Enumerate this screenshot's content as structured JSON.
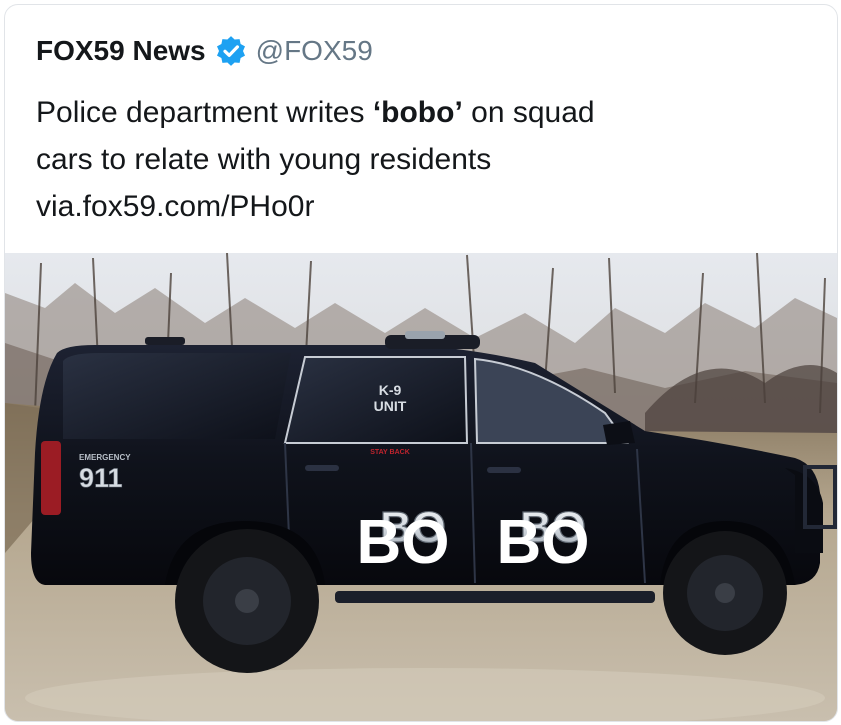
{
  "tweet": {
    "display_name": "FOX59 News",
    "handle": "@FOX59",
    "text_part1": "Police department writes ",
    "text_bold": "‘bobo’",
    "text_part2": " on squad",
    "text_line2": "cars to relate with young residents",
    "link": "via.fox59.com/PHo0r",
    "verified_icon": "verified-badge-icon",
    "accent_color": "#1da1f2"
  },
  "photo": {
    "subject": "police-suv",
    "decals": {
      "window_line1": "K-9",
      "window_line2": "UNIT",
      "window_warning": "STAY BACK",
      "rear_small": "EMERGENCY",
      "rear_big": "911",
      "door_text_1": "BO",
      "door_text_2": "BO",
      "overlay_1": "BO",
      "overlay_2": "BO"
    },
    "colors": {
      "body": "#11141e",
      "sky": "#dfe4ea",
      "ground": "#b8ab96"
    }
  }
}
